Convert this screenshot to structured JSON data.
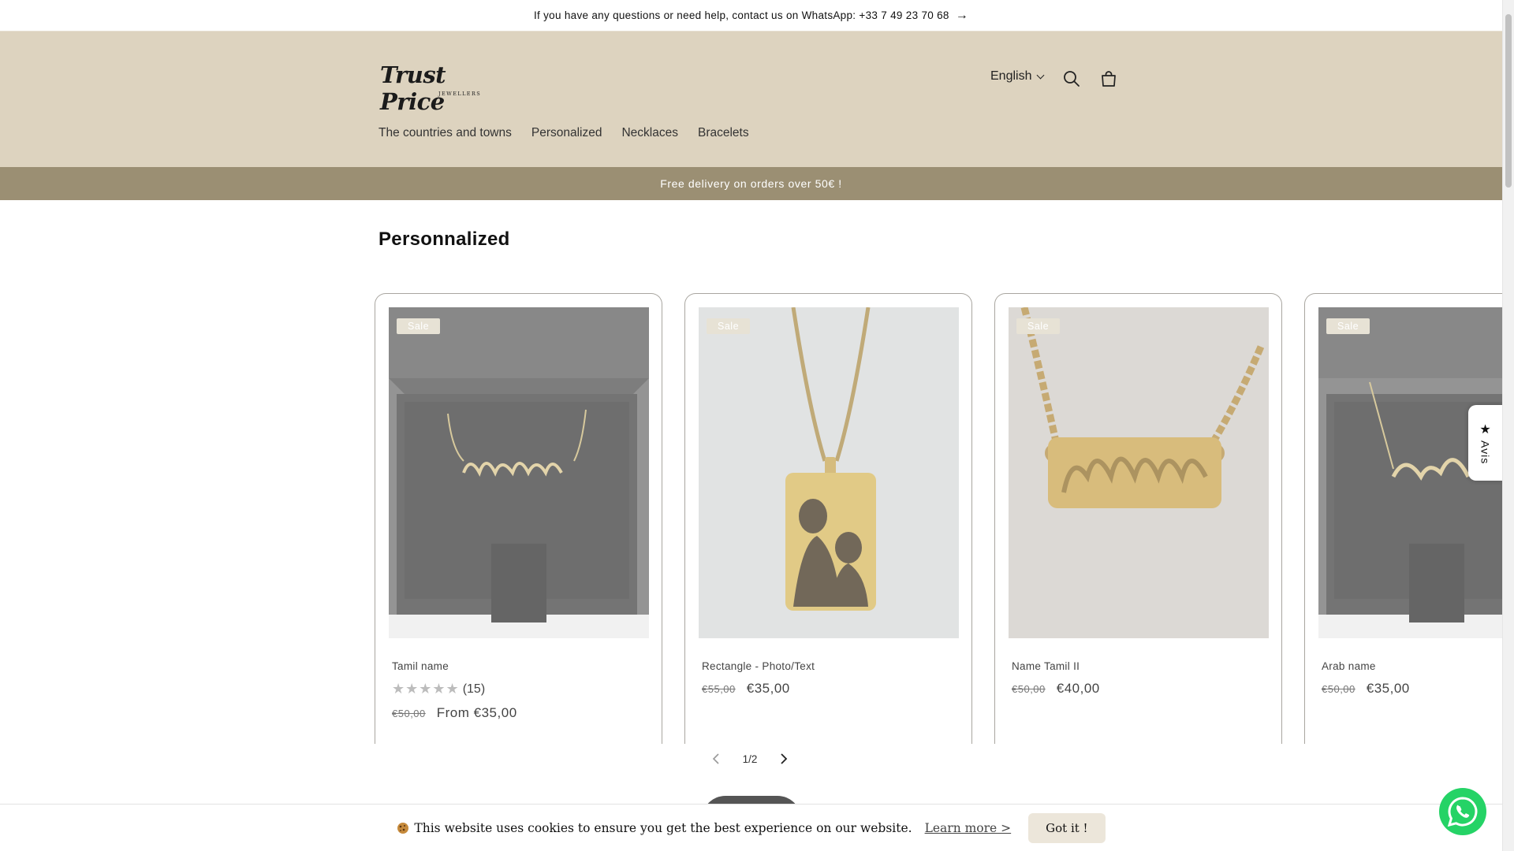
{
  "announcement": {
    "text": "If you have any questions or need help, contact us on WhatsApp: +33 7 49 23 70 68",
    "arrow_icon": "arrow-right-icon"
  },
  "header": {
    "logo_main": "Trust Price",
    "logo_sub": "JEWELLERS",
    "language": "English",
    "icons": [
      "search-icon",
      "cart-icon",
      "chevron-down-icon"
    ]
  },
  "nav": {
    "items": [
      {
        "label": "The countries and towns"
      },
      {
        "label": "Personalized"
      },
      {
        "label": "Necklaces"
      },
      {
        "label": "Bracelets"
      }
    ]
  },
  "promo": {
    "text": "Free delivery on orders over 50€ !"
  },
  "section": {
    "title": "Personnalized"
  },
  "products": [
    {
      "badge": "Sale",
      "title": "Tamil name",
      "rating_count": "(15)",
      "rating": 5,
      "old_price": "€50,00",
      "price": "From €35,00",
      "image": "tamil-name-necklace-in-box"
    },
    {
      "badge": "Sale",
      "title": "Rectangle - Photo/Text",
      "old_price": "€55,00",
      "price": "€35,00",
      "image": "photo-rectangle-pendant"
    },
    {
      "badge": "Sale",
      "title": "Name Tamil II",
      "old_price": "€50,00",
      "price": "€40,00",
      "image": "tamil-name-plate-necklace"
    },
    {
      "badge": "Sale",
      "title": "Arab name",
      "old_price": "€50,00",
      "price": "€35,00",
      "image": "arab-name-necklace-in-box"
    }
  ],
  "pager": {
    "text": "1/2"
  },
  "avis": {
    "label": "Avis",
    "icon": "star-icon"
  },
  "cookie": {
    "message": "This website uses cookies to ensure you get the best experience on our website.",
    "learn_more": "Learn more >",
    "accept": "Got it !",
    "icon": "cookie-icon"
  },
  "whatsapp": {
    "icon": "whatsapp-icon"
  },
  "colors": {
    "header_bg": "#ddd3bf",
    "promo_bg": "#9b8f73",
    "whatsapp": "#25d366"
  }
}
